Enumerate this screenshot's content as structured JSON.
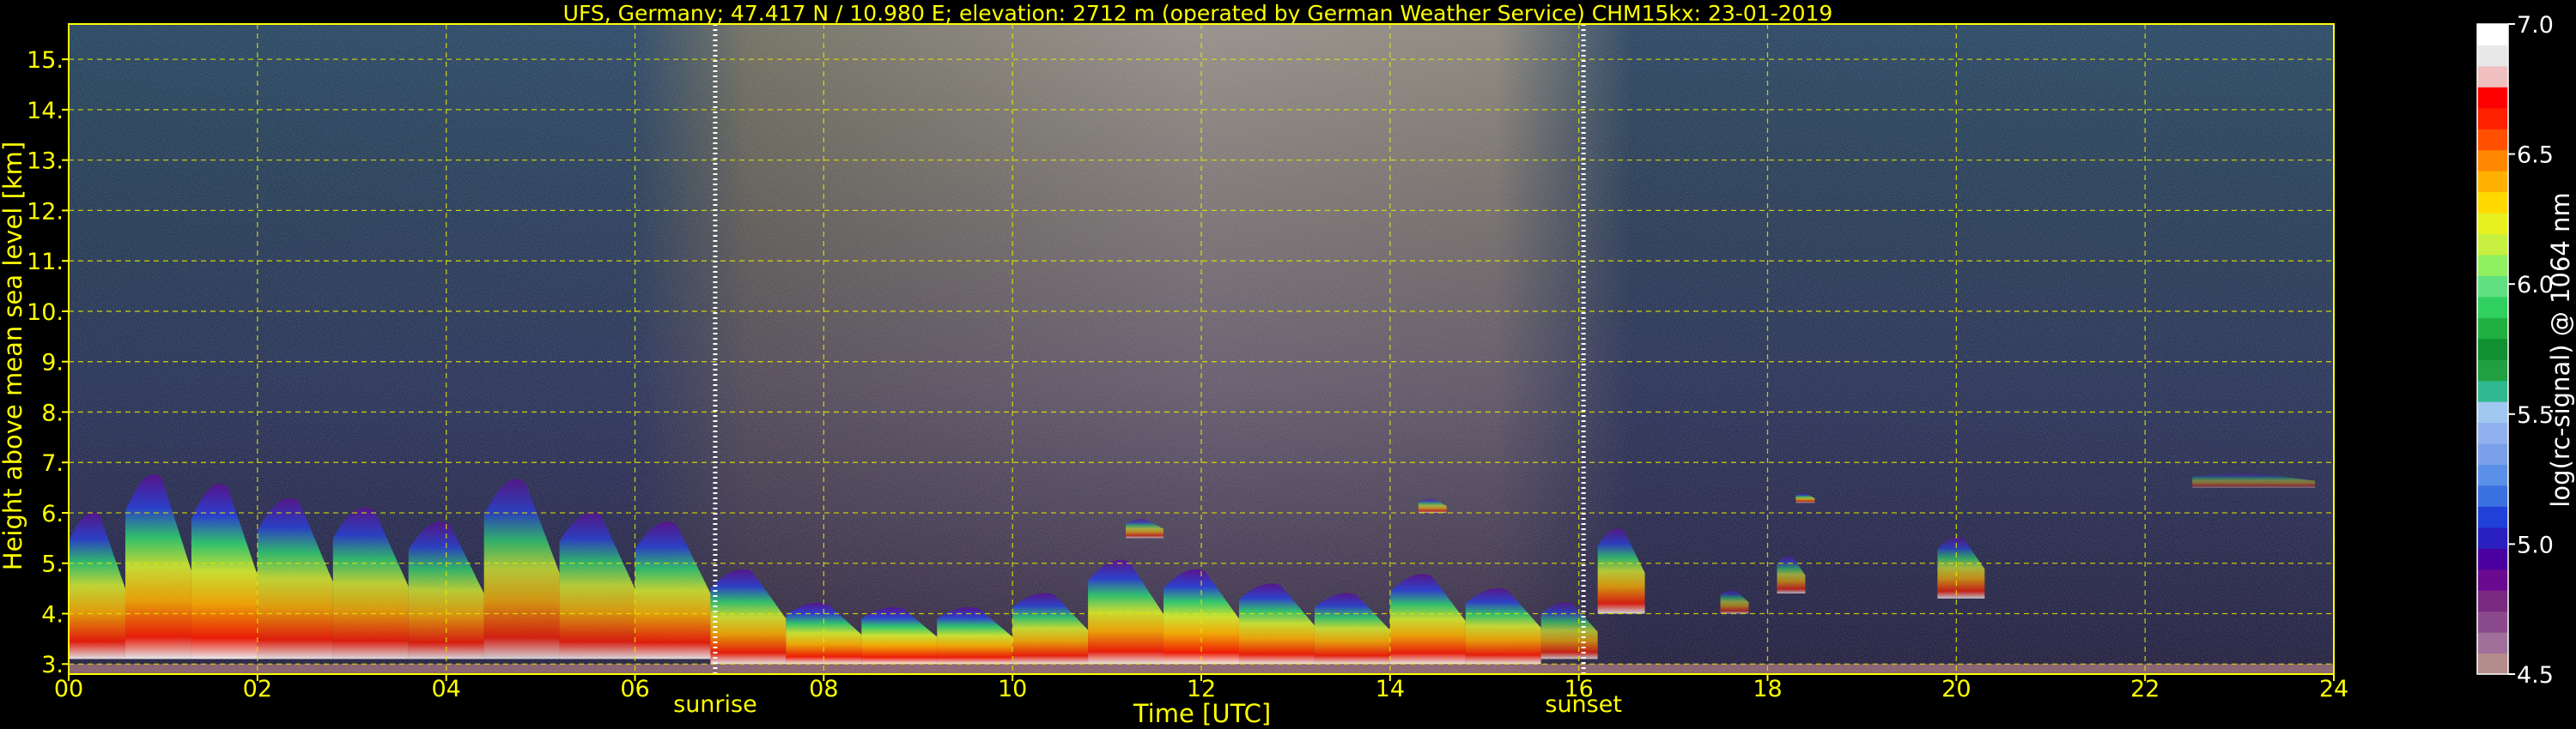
{
  "chart_data": {
    "type": "heatmap",
    "title": "UFS, Germany; 47.417 N / 10.980 E; elevation: 2712 m  (operated by German Weather Service)    CHM15kx: 23-01-2019",
    "xlabel": "Time [UTC]",
    "ylabel": "Height above mean sea level [km]",
    "xlim": [
      0,
      24
    ],
    "ylim": [
      2.8,
      15.7
    ],
    "x_ticks": [
      "00",
      "02",
      "04",
      "06",
      "08",
      "10",
      "12",
      "14",
      "16",
      "18",
      "20",
      "22",
      "24"
    ],
    "y_ticks": [
      "3.",
      "4.",
      "5.",
      "6.",
      "7.",
      "8.",
      "9.",
      "10.",
      "11.",
      "12.",
      "13.",
      "14.",
      "15."
    ],
    "grid": true,
    "markers": [
      {
        "label": "sunrise",
        "x": 6.85
      },
      {
        "label": "sunset",
        "x": 16.05
      }
    ],
    "colorbar": {
      "label": "log(rc-signal) @ 1064 nm",
      "range": [
        4.5,
        7.0
      ],
      "ticks": [
        "4.5",
        "5.0",
        "5.5",
        "6.0",
        "6.5",
        "7.0"
      ],
      "colors": [
        "#b48c8c",
        "#a0709a",
        "#8a4a8c",
        "#7a2a80",
        "#6a0a90",
        "#4a00a0",
        "#2a20c0",
        "#2040d8",
        "#3a70e0",
        "#5a90e8",
        "#7aa0ea",
        "#90b0ee",
        "#a0c8f0",
        "#30b890",
        "#20a040",
        "#109030",
        "#20b040",
        "#30d060",
        "#60e080",
        "#90f060",
        "#c8f040",
        "#e8f020",
        "#ffd800",
        "#ffb000",
        "#ff8800",
        "#ff5000",
        "#ff2000",
        "#ff0000",
        "#f0c0c0",
        "#e8e8e8",
        "#ffffff"
      ]
    },
    "layers": [
      {
        "x0": 0.0,
        "x1": 0.6,
        "ylow": 3.1,
        "yhigh": 6.2,
        "intensity": 0.85
      },
      {
        "x0": 0.6,
        "x1": 1.3,
        "ylow": 3.1,
        "yhigh": 7.0,
        "intensity": 0.88
      },
      {
        "x0": 1.3,
        "x1": 2.0,
        "ylow": 3.1,
        "yhigh": 6.8,
        "intensity": 0.9
      },
      {
        "x0": 2.0,
        "x1": 2.8,
        "ylow": 3.1,
        "yhigh": 6.5,
        "intensity": 0.84
      },
      {
        "x0": 2.8,
        "x1": 3.6,
        "ylow": 3.1,
        "yhigh": 6.3,
        "intensity": 0.82
      },
      {
        "x0": 3.6,
        "x1": 4.4,
        "ylow": 3.1,
        "yhigh": 6.0,
        "intensity": 0.8
      },
      {
        "x0": 4.4,
        "x1": 5.2,
        "ylow": 3.1,
        "yhigh": 6.9,
        "intensity": 0.78
      },
      {
        "x0": 5.2,
        "x1": 6.0,
        "ylow": 3.1,
        "yhigh": 6.2,
        "intensity": 0.8
      },
      {
        "x0": 6.0,
        "x1": 6.8,
        "ylow": 3.1,
        "yhigh": 6.0,
        "intensity": 0.84
      },
      {
        "x0": 6.8,
        "x1": 7.6,
        "ylow": 3.0,
        "yhigh": 5.0,
        "intensity": 0.86
      },
      {
        "x0": 7.6,
        "x1": 8.4,
        "ylow": 3.0,
        "yhigh": 4.3,
        "intensity": 0.9
      },
      {
        "x0": 8.4,
        "x1": 9.2,
        "ylow": 3.0,
        "yhigh": 4.2,
        "intensity": 0.92
      },
      {
        "x0": 9.2,
        "x1": 10.0,
        "ylow": 3.0,
        "yhigh": 4.2,
        "intensity": 0.9
      },
      {
        "x0": 10.0,
        "x1": 10.8,
        "ylow": 3.0,
        "yhigh": 4.5,
        "intensity": 0.86
      },
      {
        "x0": 10.8,
        "x1": 11.6,
        "ylow": 3.0,
        "yhigh": 5.2,
        "intensity": 0.88
      },
      {
        "x0": 11.6,
        "x1": 12.4,
        "ylow": 3.0,
        "yhigh": 5.0,
        "intensity": 0.92
      },
      {
        "x0": 12.4,
        "x1": 13.2,
        "ylow": 3.0,
        "yhigh": 4.7,
        "intensity": 0.88
      },
      {
        "x0": 13.2,
        "x1": 14.0,
        "ylow": 3.0,
        "yhigh": 4.5,
        "intensity": 0.86
      },
      {
        "x0": 14.0,
        "x1": 14.8,
        "ylow": 3.0,
        "yhigh": 4.9,
        "intensity": 0.88
      },
      {
        "x0": 14.8,
        "x1": 15.6,
        "ylow": 3.0,
        "yhigh": 4.6,
        "intensity": 0.86
      },
      {
        "x0": 15.6,
        "x1": 16.2,
        "ylow": 3.1,
        "yhigh": 4.3,
        "intensity": 0.7
      },
      {
        "x0": 16.2,
        "x1": 16.7,
        "ylow": 4.0,
        "yhigh": 5.8,
        "intensity": 0.78
      },
      {
        "x0": 17.5,
        "x1": 17.8,
        "ylow": 4.0,
        "yhigh": 4.5,
        "intensity": 0.55
      },
      {
        "x0": 18.1,
        "x1": 18.4,
        "ylow": 4.4,
        "yhigh": 5.2,
        "intensity": 0.62
      },
      {
        "x0": 19.8,
        "x1": 20.3,
        "ylow": 4.3,
        "yhigh": 5.6,
        "intensity": 0.7
      },
      {
        "x0": 18.3,
        "x1": 18.5,
        "ylow": 6.2,
        "yhigh": 6.4,
        "intensity": 0.68
      },
      {
        "x0": 22.5,
        "x1": 23.8,
        "ylow": 6.5,
        "yhigh": 6.8,
        "intensity": 0.4
      },
      {
        "x0": 11.2,
        "x1": 11.6,
        "ylow": 5.5,
        "yhigh": 5.9,
        "intensity": 0.6
      },
      {
        "x0": 14.3,
        "x1": 14.6,
        "ylow": 6.0,
        "yhigh": 6.3,
        "intensity": 0.6
      }
    ]
  }
}
